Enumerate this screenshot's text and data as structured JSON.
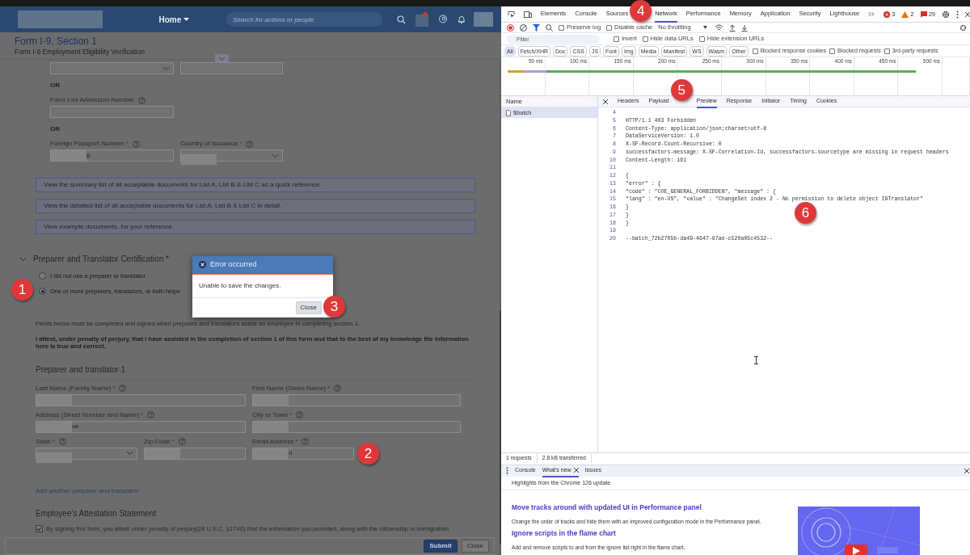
{
  "header": {
    "nav": "Home",
    "search_placeholder": "Search for actions or people"
  },
  "form": {
    "title": "Form I-9, Section 1",
    "subtitle": "Form I-9 Employment Eligibility Verification"
  },
  "blocks": [
    {
      "kind": "fields",
      "fields": [
        {
          "kind": "select"
        },
        {
          "kind": "input"
        }
      ]
    },
    {
      "kind": "or",
      "text": "OR"
    },
    {
      "kind": "fields",
      "fields": [
        {
          "kind": "input",
          "label": "Form I-94 Admission Number"
        }
      ]
    },
    {
      "kind": "or",
      "text": "OR"
    },
    {
      "kind": "fields",
      "fields": [
        {
          "kind": "input",
          "label": "Foreign Passport Number",
          "required": "*",
          "value": "6",
          "redacted": true
        },
        {
          "kind": "select",
          "label": "Country of Issuance",
          "required": "*",
          "redacted": true
        }
      ]
    }
  ],
  "reference_links": [
    "View the summary list of all acceptable documents for List A, List B & List C as a quick reference.",
    "View the detailed list of all acceptable documents for List A, List B & List C in detail.",
    "View example documents. for your reference."
  ],
  "certification": {
    "heading": "Preparer and Translator Certification *",
    "expanded": true,
    "options": [
      {
        "label": "I did not use a preparer or translator",
        "selected": false
      },
      {
        "label": "One or more preparers, translators, or both helpe",
        "selected": true
      }
    ],
    "note": "Fields below must be completed and signed when prepares and translators assist an employee in completing section 1.",
    "attestation": "I attest, under penalty of perjury, that I have assisted in the completion of section 1 of this form and that to the best of my knowledge the information here is true and correct.",
    "preparer": {
      "heading": "Preparer and translator 1",
      "rows": [
        [
          {
            "kind": "input",
            "label": "Last Name (Family Name)",
            "required": "*",
            "redacted": true
          },
          {
            "kind": "input",
            "label": "First Name (Given Name)",
            "required": "*",
            "redacted": true
          }
        ],
        [
          {
            "kind": "input",
            "label": "Address (Street Number and Name)",
            "required": "*",
            "value": "ve",
            "redacted": true
          },
          {
            "kind": "input",
            "label": "City or Town",
            "required": "*",
            "redacted": true
          }
        ],
        [
          {
            "kind": "select",
            "label": "State",
            "required": "*",
            "redacted": true
          },
          {
            "kind": "input",
            "label": "Zip Code",
            "required": "*",
            "redacted": true
          },
          {
            "kind": "input",
            "label": "Email Address",
            "required": "*",
            "value": "n",
            "redacted": true
          }
        ]
      ]
    },
    "add_link": "Add another preparer and translator"
  },
  "employee_attestation": {
    "heading": "Employee's Attestation Statement",
    "checked": true,
    "text": "By signing this form, you attest under penalty of perjury(28 U.S.C. §1746) that the information you provided, along with the citizenship or immigration"
  },
  "footer_buttons": [
    {
      "label": "Submit",
      "kind": "primary"
    },
    {
      "label": "Close",
      "kind": "secondary"
    }
  ],
  "dialog": {
    "title": "Error occurred",
    "message": "Unable to save the changes.",
    "button": "Close"
  },
  "callouts": [
    "1",
    "2",
    "3",
    "4",
    "5",
    "6"
  ],
  "devtools": {
    "main_tabs": [
      {
        "label": "Elements",
        "selected": false
      },
      {
        "label": "Console",
        "selected": false
      },
      {
        "label": "Sources",
        "selected": false
      },
      {
        "label": "Network",
        "selected": true
      },
      {
        "label": "Performance",
        "selected": false
      },
      {
        "label": "Memory",
        "selected": false
      },
      {
        "label": "Application",
        "selected": false
      },
      {
        "label": "Security",
        "selected": false
      },
      {
        "label": "Lighthouse",
        "selected": false
      }
    ],
    "counters": [
      {
        "kind": "error",
        "count": "3"
      },
      {
        "kind": "warning",
        "count": "2"
      },
      {
        "kind": "issue",
        "count": "29"
      }
    ],
    "toolbar_checks": [
      {
        "label": "Preserve log",
        "checked": false
      },
      {
        "label": "Disable cache",
        "checked": false
      }
    ],
    "throttling": "No throttling",
    "filter_placeholder": "Filter",
    "filter_checks": [
      {
        "label": "Invert",
        "checked": false
      },
      {
        "label": "Hide data URLs",
        "checked": false
      },
      {
        "label": "Hide extension URLs",
        "checked": false
      }
    ],
    "type_filters": [
      {
        "label": "All",
        "selected": true
      },
      {
        "label": "Fetch/XHR",
        "selected": false
      },
      {
        "label": "Doc",
        "selected": false
      },
      {
        "label": "CSS",
        "selected": false
      },
      {
        "label": "JS",
        "selected": false
      },
      {
        "label": "Font",
        "selected": false
      },
      {
        "label": "Img",
        "selected": false
      },
      {
        "label": "Media",
        "selected": false
      },
      {
        "label": "Manifest",
        "selected": false
      },
      {
        "label": "WS",
        "selected": false
      },
      {
        "label": "Wasm",
        "selected": false
      },
      {
        "label": "Other",
        "selected": false
      }
    ],
    "more_checks": [
      {
        "label": "Blocked response cookies",
        "checked": false
      },
      {
        "label": "Blocked requests",
        "checked": false
      },
      {
        "label": "3rd-party requests",
        "checked": false
      }
    ],
    "timeline_ticks": [
      "50 ms",
      "100 ms",
      "150 ms",
      "200 ms",
      "250 ms",
      "300 ms",
      "350 ms",
      "400 ms",
      "450 ms",
      "500 ms"
    ],
    "name_column": "Name",
    "requests": [
      {
        "name": "$batch",
        "selected": true
      }
    ],
    "detail_tabs": [
      {
        "label": "Headers",
        "selected": false
      },
      {
        "label": "Payload",
        "selected": false
      },
      {
        "label": "Preview",
        "selected": true
      },
      {
        "label": "Response",
        "selected": false
      },
      {
        "label": "Initiator",
        "selected": false
      },
      {
        "label": "Timing",
        "selected": false
      },
      {
        "label": "Cookies",
        "selected": false
      }
    ],
    "response_lines": [
      {
        "num": "4"
      },
      {
        "num": "5",
        "text": "HTTP/1.1 403 Forbidden"
      },
      {
        "num": "6",
        "text": "Content-Type: application/json;charset=utf-8"
      },
      {
        "num": "7",
        "text": "DataServiceVersion: 1.0"
      },
      {
        "num": "8",
        "text": "X-SF-Record-Count-Recursive: 0"
      },
      {
        "num": "9",
        "text": "successfactors-message: X-SF-Correlation-Id, successfactors-sourcetype are missing in request headers"
      },
      {
        "num": "10",
        "text": "Content-Length: 161"
      },
      {
        "num": "11"
      },
      {
        "num": "12",
        "text": "{"
      },
      {
        "num": "13",
        "text": "\"error\" : {"
      },
      {
        "num": "14",
        "text": "\"code\" : \"COE_GENERAL_FORBIDDEN\", \"message\" : {"
      },
      {
        "num": "15",
        "text": "\"lang\" : \"en-US\", \"value\" : \"ChangeSet index 2 - No permission to delete object I9Translator\""
      },
      {
        "num": "16",
        "text": "}"
      },
      {
        "num": "17",
        "text": "}"
      },
      {
        "num": "18",
        "text": "}"
      },
      {
        "num": "19"
      },
      {
        "num": "20",
        "text": "--batch_72b2705b-da49-4647-97ae-c520a05c4532--"
      }
    ],
    "status": [
      "1 requests",
      "2.8 kB transferred"
    ],
    "drawer_tabs": [
      {
        "label": "Console",
        "selected": false,
        "closable": false
      },
      {
        "label": "What's new",
        "selected": true,
        "closable": true
      },
      {
        "label": "Issues",
        "selected": false,
        "closable": false
      }
    ],
    "whats_new": {
      "intro": "Highlights from the Chrome 126 update",
      "articles": [
        {
          "title": "Move tracks around with updated UI in Performance panel",
          "text": "Change the order of tracks and hide them with an improved configuration mode in the Performance panel."
        },
        {
          "title": "Ignore scripts in the flame chart",
          "text": "Add and remove scripts to and from the ignore list right in the flame chart."
        }
      ]
    }
  }
}
